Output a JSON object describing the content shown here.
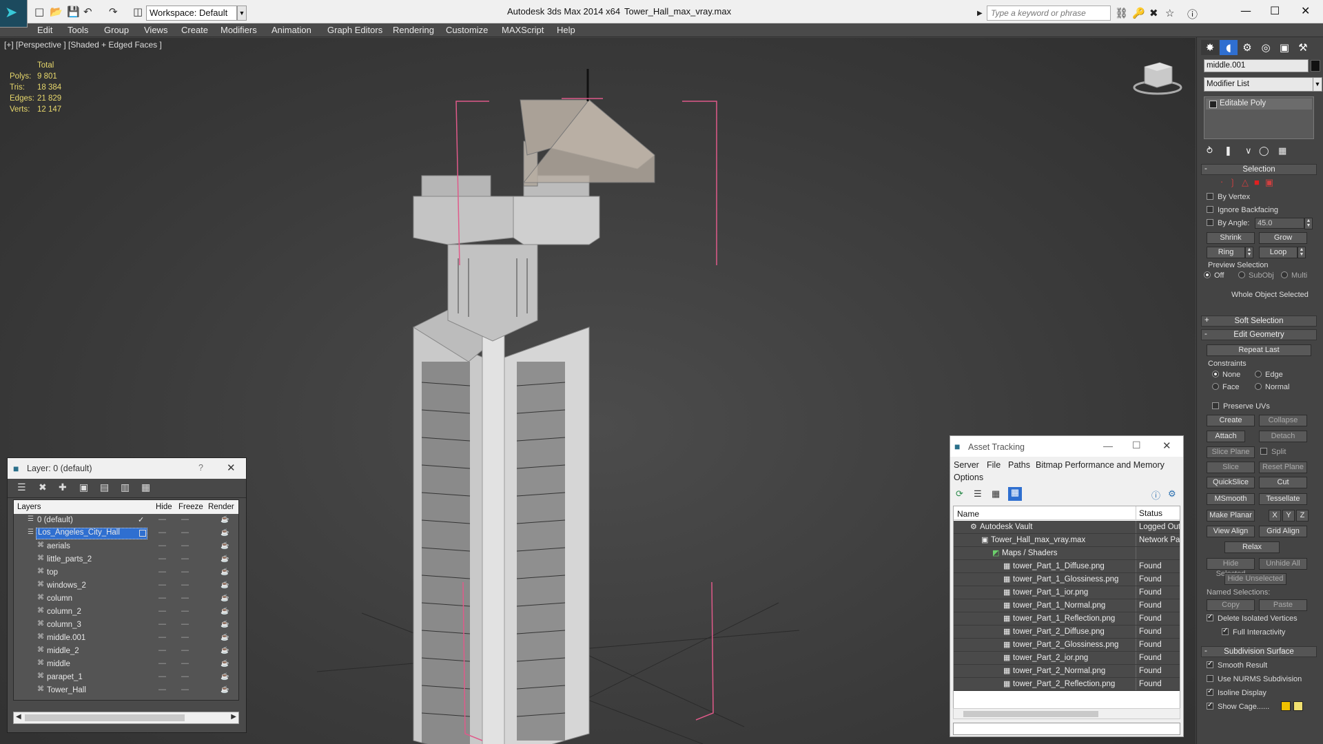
{
  "app": {
    "title": "Autodesk 3ds Max  2014 x64",
    "file": "Tower_Hall_max_vray.max",
    "workspace": "Workspace: Default",
    "search_placeholder": "Type a keyword or phrase"
  },
  "menu": [
    "Edit",
    "Tools",
    "Group",
    "Views",
    "Create",
    "Modifiers",
    "Animation",
    "Graph Editors",
    "Rendering",
    "Customize",
    "MAXScript",
    "Help"
  ],
  "viewport": {
    "label": "[+] [Perspective ] [Shaded + Edged Faces ]",
    "stats": {
      "header": "Total",
      "rows": [
        {
          "k": "Polys:",
          "v": "9 801"
        },
        {
          "k": "Tris:",
          "v": "18 384"
        },
        {
          "k": "Edges:",
          "v": "21 829"
        },
        {
          "k": "Verts:",
          "v": "12 147"
        }
      ]
    }
  },
  "command_panel": {
    "object_name": "middle.001",
    "modifier_list": "Modifier List",
    "stack_item": "Editable Poly",
    "selection": {
      "title": "Selection",
      "by_vertex": "By Vertex",
      "ignore_backfacing": "Ignore Backfacing",
      "by_angle": "By Angle:",
      "angle_value": "45.0",
      "shrink": "Shrink",
      "grow": "Grow",
      "ring": "Ring",
      "loop": "Loop",
      "preview_selection": "Preview Selection",
      "preview_off": "Off",
      "preview_subobj": "SubObj",
      "preview_multi": "Multi",
      "status": "Whole Object Selected"
    },
    "soft_selection": "Soft Selection",
    "edit_geometry": {
      "title": "Edit Geometry",
      "repeat_last": "Repeat Last",
      "constraints": "Constraints",
      "none": "None",
      "edge": "Edge",
      "face": "Face",
      "normal": "Normal",
      "preserve_uvs": "Preserve UVs",
      "create": "Create",
      "collapse": "Collapse",
      "attach": "Attach",
      "detach": "Detach",
      "slice_plane": "Slice Plane",
      "split": "Split",
      "slice": "Slice",
      "reset_plane": "Reset Plane",
      "quickslice": "QuickSlice",
      "cut": "Cut",
      "msmooth": "MSmooth",
      "tessellate": "Tessellate",
      "make_planar": "Make Planar",
      "x": "X",
      "y": "Y",
      "z": "Z",
      "view_align": "View Align",
      "grid_align": "Grid Align",
      "relax": "Relax",
      "hide_selected": "Hide Selected",
      "unhide_all": "Unhide All",
      "hide_unselected": "Hide Unselected",
      "named_selections": "Named Selections:",
      "copy": "Copy",
      "paste": "Paste",
      "delete_isolated": "Delete Isolated Vertices",
      "full_interactivity": "Full Interactivity"
    },
    "subdivision_surface": {
      "title": "Subdivision Surface",
      "smooth_result": "Smooth Result",
      "use_nurms": "Use NURMS Subdivision",
      "isoline_display": "Isoline Display",
      "show_cage": "Show Cage......"
    }
  },
  "layer_explorer": {
    "title": "Layer: 0 (default)",
    "help": "?",
    "columns": {
      "layers": "Layers",
      "hide": "Hide",
      "freeze": "Freeze",
      "render": "Render"
    },
    "rows": [
      {
        "name": "0 (default)",
        "level": 0
      },
      {
        "name": "Los_Angeles_City_Hall",
        "level": 0
      },
      {
        "name": "aerials",
        "level": 1
      },
      {
        "name": "little_parts_2",
        "level": 1
      },
      {
        "name": "top",
        "level": 1
      },
      {
        "name": "windows_2",
        "level": 1
      },
      {
        "name": "column",
        "level": 1
      },
      {
        "name": "column_2",
        "level": 1
      },
      {
        "name": "column_3",
        "level": 1
      },
      {
        "name": "middle.001",
        "level": 1
      },
      {
        "name": "middle_2",
        "level": 1
      },
      {
        "name": "middle",
        "level": 1
      },
      {
        "name": "parapet_1",
        "level": 1
      },
      {
        "name": "Tower_Hall",
        "level": 1
      }
    ]
  },
  "asset_tracking": {
    "title": "Asset Tracking",
    "menu": [
      "Server",
      "File",
      "Paths",
      "Bitmap Performance and Memory",
      "Options"
    ],
    "columns": {
      "name": "Name",
      "status": "Status"
    },
    "rows": [
      {
        "name": "Autodesk Vault",
        "status": "Logged Out",
        "level": 0
      },
      {
        "name": "Tower_Hall_max_vray.max",
        "status": "Network Pat",
        "level": 1
      },
      {
        "name": "Maps / Shaders",
        "status": "",
        "level": 2
      },
      {
        "name": "tower_Part_1_Diffuse.png",
        "status": "Found",
        "level": 3
      },
      {
        "name": "tower_Part_1_Glossiness.png",
        "status": "Found",
        "level": 3
      },
      {
        "name": "tower_Part_1_ior.png",
        "status": "Found",
        "level": 3
      },
      {
        "name": "tower_Part_1_Normal.png",
        "status": "Found",
        "level": 3
      },
      {
        "name": "tower_Part_1_Reflection.png",
        "status": "Found",
        "level": 3
      },
      {
        "name": "tower_Part_2_Diffuse.png",
        "status": "Found",
        "level": 3
      },
      {
        "name": "tower_Part_2_Glossiness.png",
        "status": "Found",
        "level": 3
      },
      {
        "name": "tower_Part_2_ior.png",
        "status": "Found",
        "level": 3
      },
      {
        "name": "tower_Part_2_Normal.png",
        "status": "Found",
        "level": 3
      },
      {
        "name": "tower_Part_2_Reflection.png",
        "status": "Found",
        "level": 3
      }
    ]
  },
  "colors": {
    "stats_text": "#e8d86c",
    "selection_box": "#e05a8a",
    "selected_layer": "#2f6fd0"
  }
}
